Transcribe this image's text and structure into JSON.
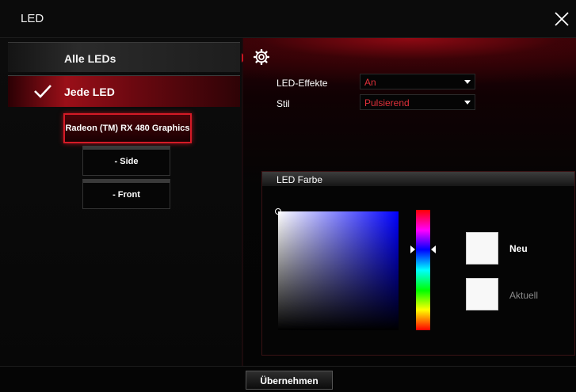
{
  "window": {
    "title": "LED",
    "close_icon": "close-icon"
  },
  "sidebar": {
    "tabs": [
      {
        "label": "Alle LEDs",
        "selected": false
      },
      {
        "label": "Jede LED",
        "selected": true,
        "icon": "checkmark-icon"
      }
    ],
    "device": {
      "label": "Radeon (TM) RX 480 Graphics"
    },
    "zones": [
      {
        "label": "- Side"
      },
      {
        "label": "- Front"
      }
    ]
  },
  "settings": {
    "icon": "gear-icon",
    "effects": {
      "label": "LED-Effekte",
      "value": "An"
    },
    "style": {
      "label": "Stil",
      "value": "Pulsierend"
    }
  },
  "color_panel": {
    "title": "LED Farbe",
    "new_label": "Neu",
    "current_label": "Aktuell",
    "new_color": "#f8f8f8",
    "current_color": "#f8f8f8"
  },
  "footer": {
    "apply_label": "Übernehmen"
  },
  "colors": {
    "accent": "#d41a26",
    "dropdown_text": "#e0303a"
  }
}
